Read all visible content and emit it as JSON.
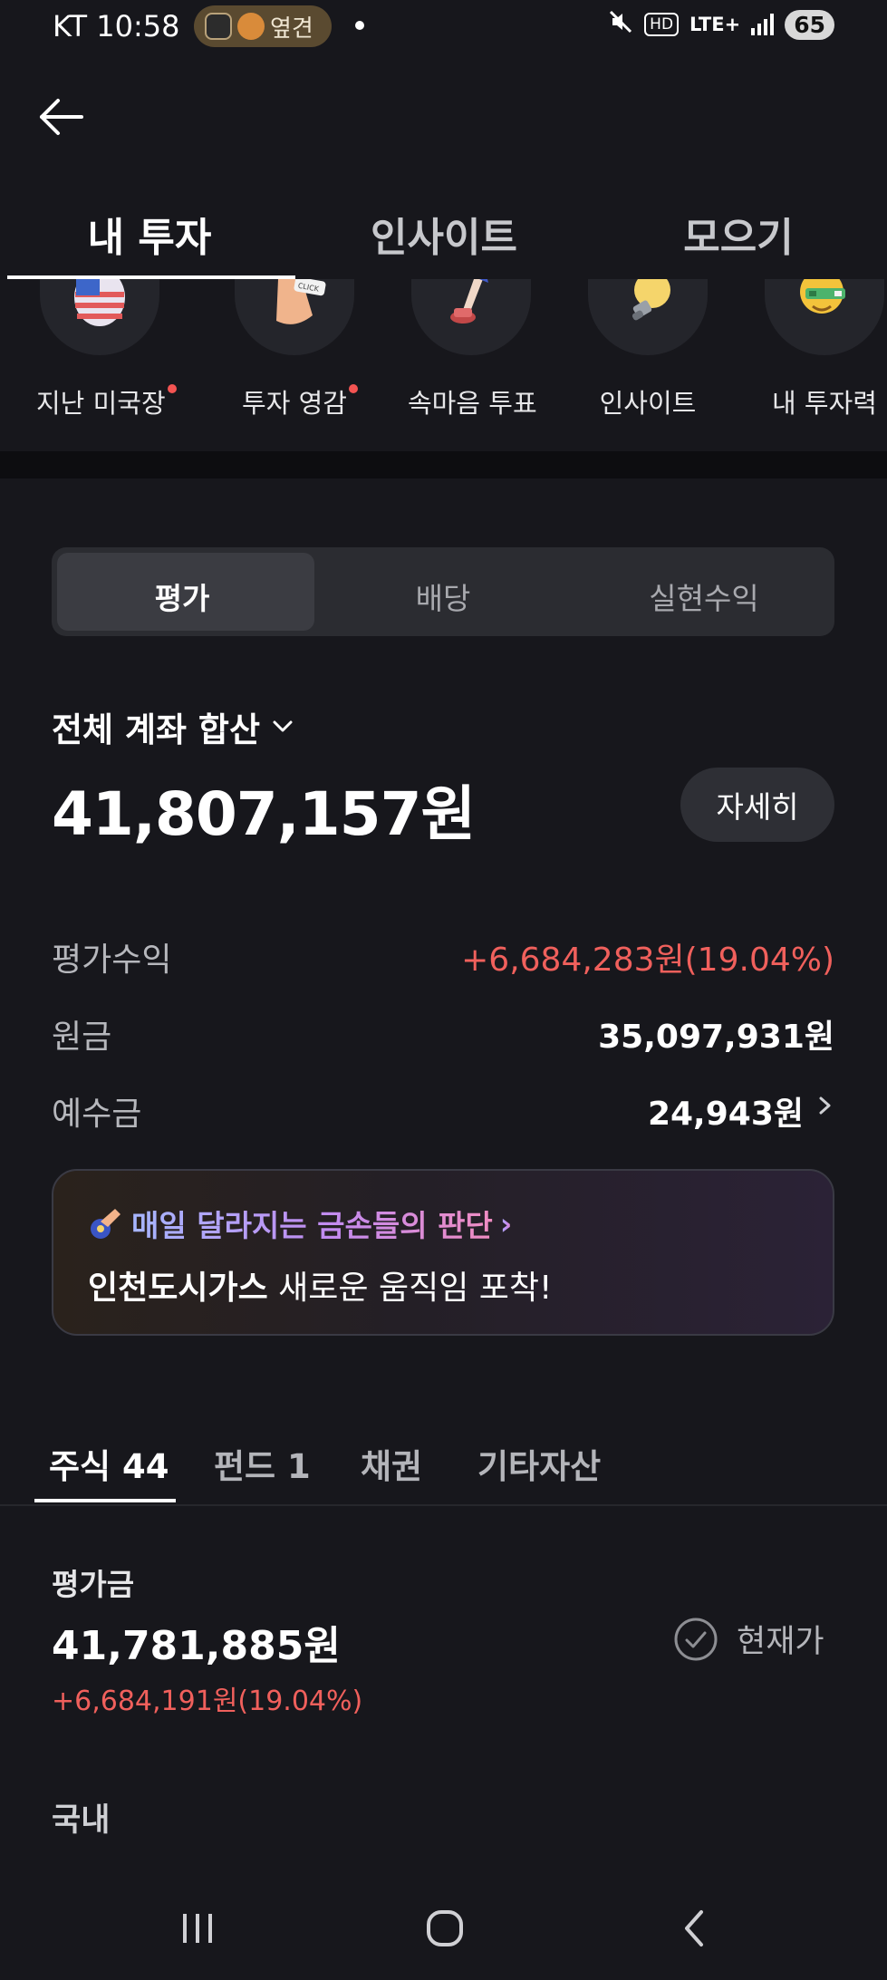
{
  "status_bar": {
    "carrier_time": "KT 10:58",
    "pill_text": "옆견",
    "battery": "65",
    "hd_label": "HD",
    "network_label": "LTE+"
  },
  "tabs": [
    {
      "label": "내 투자",
      "active": true
    },
    {
      "label": "인사이트",
      "active": false
    },
    {
      "label": "모으기",
      "active": false
    }
  ],
  "shortcuts": [
    {
      "label": "지난 미국장",
      "icon": "us-flag-egg-icon",
      "new": true
    },
    {
      "label": "투자 영감",
      "icon": "click-hand-icon",
      "new": true
    },
    {
      "label": "속마음 투표",
      "icon": "stamp-vote-icon",
      "new": false
    },
    {
      "label": "인사이트",
      "icon": "lightbulb-icon",
      "new": false
    },
    {
      "label": "내 투자력",
      "icon": "smiley-score-icon",
      "new": false
    }
  ],
  "segment": {
    "options": [
      "평가",
      "배당",
      "실현수익"
    ],
    "selected": "평가"
  },
  "account": {
    "title": "전체 계좌 합산",
    "total": "41,807,157원",
    "detail_button": "자세히",
    "rows": [
      {
        "label": "평가수익",
        "value": "+6,684,283원(19.04%)"
      },
      {
        "label": "원금",
        "value": "35,097,931원"
      },
      {
        "label": "예수금",
        "value": "24,943원"
      }
    ]
  },
  "banner": {
    "headline": "매일 달라지는 금손들의 판단",
    "headline_arrow": "›",
    "stock_name": "인천도시가스",
    "message": " 새로운 움직임 포착!"
  },
  "asset_tabs": [
    {
      "label": "주식 44",
      "active": true
    },
    {
      "label": "펀드 1",
      "active": false
    },
    {
      "label": "채권",
      "active": false
    },
    {
      "label": "기타자산",
      "active": false
    }
  ],
  "evaluation": {
    "title": "평가금",
    "value": "41,781,885원",
    "change": "+6,684,191원(19.04%)",
    "current_price_label": "현재가"
  },
  "section": {
    "domestic_label": "국내"
  },
  "colors": {
    "background": "#17171c",
    "positive": "#f0605c",
    "surface": "#2b2c31"
  }
}
